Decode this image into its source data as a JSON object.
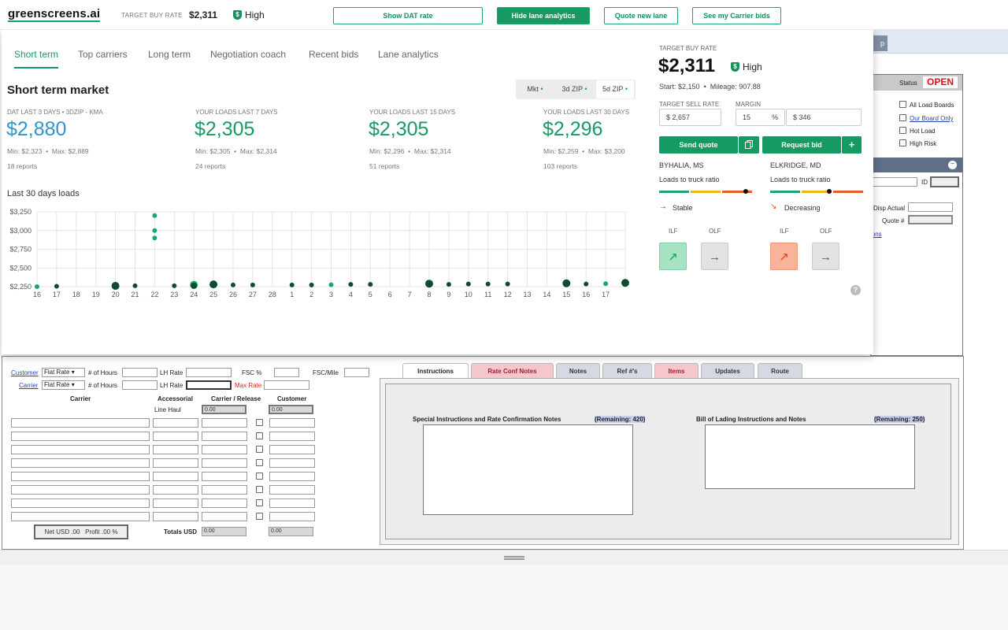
{
  "topbar": {
    "logo": "greenscreens.ai",
    "target_label": "TARGET BUY RATE",
    "target_value": "$2,311",
    "confidence": "High",
    "shield_glyph": "$",
    "buttons": [
      "Show DAT rate",
      "Hide lane analytics",
      "Quote new lane",
      "See my Carrier bids"
    ]
  },
  "tabs": [
    "Short term",
    "Top carriers",
    "Long term",
    "Negotiation coach",
    "Recent bids",
    "Lane analytics"
  ],
  "market": {
    "title": "Short term market",
    "segments": [
      "Mkt",
      "3d ZIP",
      "5d ZIP"
    ],
    "segment_dots": [
      "•",
      "•",
      "•"
    ],
    "stats": [
      {
        "label": "DAT LAST 3 DAYS • 3DZIP - KMA",
        "value": "$2,880",
        "min": "Min: $2,323",
        "max": "Max: $2,889",
        "reports": "18 reports",
        "blue": true
      },
      {
        "label": "YOUR LOADS LAST 7 DAYS",
        "value": "$2,305",
        "min": "Min: $2,305",
        "max": "Max: $2,314",
        "reports": "24 reports"
      },
      {
        "label": "YOUR LOADS LAST 15 DAYS",
        "value": "$2,305",
        "min": "Min: $2,296",
        "max": "Max: $2,314",
        "reports": "51 reports"
      },
      {
        "label": "YOUR LOADS LAST 30 DAYS",
        "value": "$2,296",
        "min": "Min: $2,259",
        "max": "Max: $3,200",
        "reports": "103 reports"
      }
    ],
    "bullet": "•"
  },
  "chart_data": {
    "type": "scatter",
    "title": "Last 30 days loads",
    "categories": [
      "16",
      "17",
      "18",
      "19",
      "20",
      "21",
      "22",
      "23",
      "24",
      "25",
      "26",
      "27",
      "28",
      "1",
      "2",
      "3",
      "4",
      "5",
      "6",
      "7",
      "8",
      "9",
      "10",
      "11",
      "12",
      "13",
      "14",
      "15",
      "16",
      "17",
      ""
    ],
    "y_ticks": [
      "$3,250",
      "$3,000",
      "$2,750",
      "$2,500",
      "$2,250"
    ],
    "ylim": [
      2250,
      3250
    ],
    "grid": true,
    "points": [
      {
        "i": 0,
        "y": 2250,
        "r": 3,
        "c": "#1aa86a"
      },
      {
        "i": 1,
        "y": 2255,
        "r": 3,
        "c": "#0d4d2e"
      },
      {
        "i": 4,
        "y": 2260,
        "r": 5,
        "c": "#0d4d2e"
      },
      {
        "i": 5,
        "y": 2262,
        "r": 3,
        "c": "#0d4d2e"
      },
      {
        "i": 6,
        "y": 3200,
        "r": 3,
        "c": "#1aa86a"
      },
      {
        "i": 6,
        "y": 3000,
        "r": 3,
        "c": "#1aa86a"
      },
      {
        "i": 6,
        "y": 2900,
        "r": 3,
        "c": "#1aa86a"
      },
      {
        "i": 7,
        "y": 2262,
        "r": 3,
        "c": "#0d4d2e"
      },
      {
        "i": 8,
        "y": 2275,
        "r": 5,
        "c": "#1aa86a"
      },
      {
        "i": 8,
        "y": 2262,
        "r": 4,
        "c": "#0d4d2e"
      },
      {
        "i": 9,
        "y": 2280,
        "r": 5,
        "c": "#0d4d2e"
      },
      {
        "i": 10,
        "y": 2272,
        "r": 3,
        "c": "#0d4d2e"
      },
      {
        "i": 11,
        "y": 2272,
        "r": 3,
        "c": "#0d4d2e"
      },
      {
        "i": 13,
        "y": 2272,
        "r": 3,
        "c": "#0d4d2e"
      },
      {
        "i": 14,
        "y": 2272,
        "r": 3,
        "c": "#0d4d2e"
      },
      {
        "i": 15,
        "y": 2275,
        "r": 3,
        "c": "#1aa86a"
      },
      {
        "i": 16,
        "y": 2280,
        "r": 3,
        "c": "#0d4d2e"
      },
      {
        "i": 17,
        "y": 2280,
        "r": 3,
        "c": "#0d4d2e"
      },
      {
        "i": 20,
        "y": 2290,
        "r": 5,
        "c": "#0d4d2e"
      },
      {
        "i": 21,
        "y": 2280,
        "r": 3,
        "c": "#0d4d2e"
      },
      {
        "i": 22,
        "y": 2285,
        "r": 3,
        "c": "#0d4d2e"
      },
      {
        "i": 23,
        "y": 2285,
        "r": 3,
        "c": "#0d4d2e"
      },
      {
        "i": 24,
        "y": 2285,
        "r": 3,
        "c": "#0d4d2e"
      },
      {
        "i": 27,
        "y": 2295,
        "r": 5,
        "c": "#0d4d2e"
      },
      {
        "i": 28,
        "y": 2285,
        "r": 3,
        "c": "#0d4d2e"
      },
      {
        "i": 29,
        "y": 2290,
        "r": 3,
        "c": "#1aa86a"
      },
      {
        "i": 30,
        "y": 2300,
        "r": 5,
        "c": "#0d4d2e"
      }
    ]
  },
  "right": {
    "target_label": "TARGET BUY RATE",
    "target_value": "$2,311",
    "confidence": "High",
    "start": "Start: $2,150",
    "mileage": "Mileage: 907.88",
    "sell_label": "TARGET SELL RATE",
    "margin_label": "MARGIN",
    "sell_value": "$ 2,657",
    "margin_pct": "15",
    "pct_sign": "%",
    "margin_value": "$ 346",
    "send_quote": "Send quote",
    "request_bid": "Request bid",
    "plus": "+",
    "origin": "BYHALIA, MS",
    "dest": "ELKRIDGE, MD",
    "ratio_label": "Loads to truck ratio",
    "origin_trend": "Stable",
    "dest_trend": "Decreasing",
    "ilf": "ILF",
    "olf": "OLF",
    "help": "?",
    "trend_up": "↗",
    "trend_flat": "→",
    "trend_down": "↘"
  },
  "legacy": {
    "status_label": "Status",
    "status_value": "OPEN",
    "load_checks": [
      "All Load Boards",
      "Our Board Only",
      "Hot Load",
      "High Risk"
    ],
    "id_label": "ID",
    "disp_actual": "Disp Actual",
    "quote_no": "Quote #",
    "ions_frag": "ions",
    "rp_frag": "p",
    "minus": "−",
    "customer": "Customer",
    "carrier": "Carrier",
    "flat_rate": "Flat Rate",
    "hours": "# of Hours",
    "lh_rate": "LH Rate",
    "fsc": "FSC %",
    "fsc_mile": "FSC/Mile",
    "max_rate": "Max Rate",
    "col_carrier": "Carrier",
    "col_accessorial": "Accessorial",
    "col_carrier_release": "Carrier / Release",
    "col_customer": "Customer",
    "line_haul": "Line Haul",
    "zero": "0.00",
    "net": "Net USD .00",
    "profit": "Profit .00 %",
    "totals": "Totals USD",
    "tabs": [
      "Instructions",
      "Rate Conf Notes",
      "Notes",
      "Ref #'s",
      "Items",
      "Updates",
      "Route"
    ],
    "special_label": "Special Instructions and Rate Confirmation Notes",
    "special_remaining": "(Remaining: 420)",
    "bol_label": "Bill of Lading Instructions and Notes",
    "bol_remaining": "(Remaining: 250)"
  }
}
